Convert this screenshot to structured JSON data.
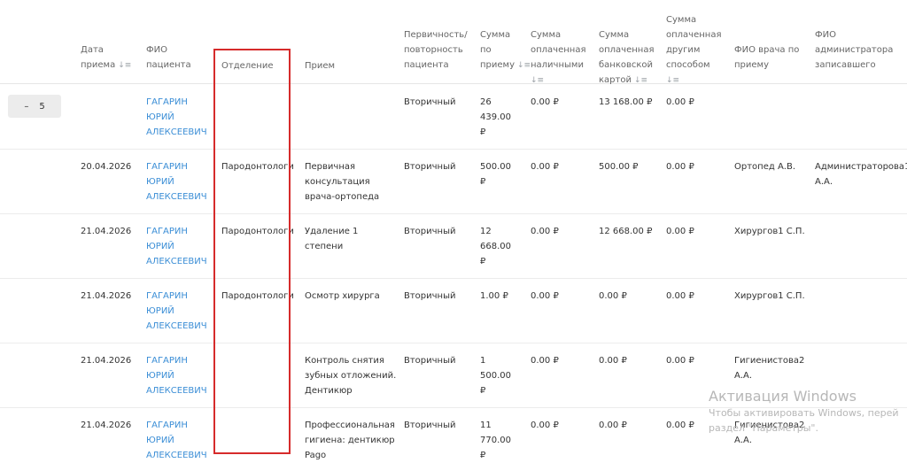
{
  "headers": {
    "date": "Дата\nприема",
    "patient": "ФИО\nпациента",
    "department": "Отделение",
    "service": "Прием",
    "primary": "Первичность/\nповторность\nпациента",
    "sum": "Сумма\nпо\nприему",
    "cash": "Сумма\nоплаченная\nналичными",
    "card": "Сумма\nоплаченная\nбанковской\nкартой",
    "other": "Сумма\nоплаченная\nдругим\nспособом",
    "doctor": "ФИО врача по\nприему",
    "admin": "ФИО\nадминистратора\nзаписавшего"
  },
  "sort_icon": "sort-icon",
  "group": {
    "toggle": "–",
    "count": "5"
  },
  "rows": [
    {
      "date": "",
      "patient": "ГАГАРИН\nЮРИЙ\nАЛЕКСЕЕВИЧ",
      "department": "",
      "service": "",
      "primary": "Вторичный",
      "sum": "26\n439.00\n₽",
      "cash": "0.00 ₽",
      "card": "13 168.00 ₽",
      "other": "0.00 ₽",
      "doctor": "",
      "admin": ""
    },
    {
      "date": "20.04.2026",
      "patient": "ГАГАРИН\nЮРИЙ\nАЛЕКСЕЕВИЧ",
      "department": "Пародонтологи",
      "service": "Первичная\nконсультация\nврача-ортопеда",
      "primary": "Вторичный",
      "sum": "500.00\n₽",
      "cash": "0.00 ₽",
      "card": "500.00 ₽",
      "other": "0.00 ₽",
      "doctor": "Ортопед А.В.",
      "admin": "Администраторова1\nА.А."
    },
    {
      "date": "21.04.2026",
      "patient": "ГАГАРИН\nЮРИЙ\nАЛЕКСЕЕВИЧ",
      "department": "Пародонтологи",
      "service": "Удаление 1\nстепени",
      "primary": "Вторичный",
      "sum": "12\n668.00\n₽",
      "cash": "0.00 ₽",
      "card": "12 668.00 ₽",
      "other": "0.00 ₽",
      "doctor": "Хирургов1 С.П.",
      "admin": ""
    },
    {
      "date": "21.04.2026",
      "patient": "ГАГАРИН\nЮРИЙ\nАЛЕКСЕЕВИЧ",
      "department": "Пародонтологи",
      "service": "Осмотр хирурга",
      "primary": "Вторичный",
      "sum": "1.00 ₽",
      "cash": "0.00 ₽",
      "card": "0.00 ₽",
      "other": "0.00 ₽",
      "doctor": "Хирургов1 С.П.",
      "admin": ""
    },
    {
      "date": "21.04.2026",
      "patient": "ГАГАРИН\nЮРИЙ\nАЛЕКСЕЕВИЧ",
      "department": "",
      "service": "Контроль снятия\nзубных отложений.\nДентикюр",
      "primary": "Вторичный",
      "sum": "1\n500.00\n₽",
      "cash": "0.00 ₽",
      "card": "0.00 ₽",
      "other": "0.00 ₽",
      "doctor": "Гигиенистова2\nА.А.",
      "admin": ""
    },
    {
      "date": "21.04.2026",
      "patient": "ГАГАРИН\nЮРИЙ\nАЛЕКСЕЕВИЧ",
      "department": "",
      "service": "Профессиональная\nгигиена: дентикюр\nPago",
      "primary": "Вторичный",
      "sum": "11\n770.00\n₽",
      "cash": "0.00 ₽",
      "card": "0.00 ₽",
      "other": "0.00 ₽",
      "doctor": "Гигиенистова2\nА.А.",
      "admin": ""
    }
  ],
  "watermark": {
    "title": "Активация Windows",
    "line1": "Чтобы активировать Windows, перей",
    "line2": "раздел \"Параметры\"."
  },
  "colors": {
    "link": "#3b8ed6",
    "highlight": "#d62b2b"
  }
}
